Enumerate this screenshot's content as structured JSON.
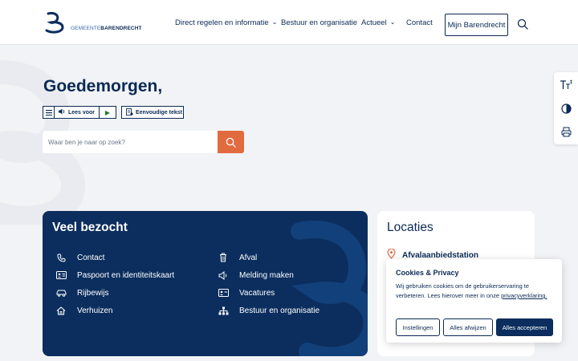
{
  "header": {
    "logo": {
      "prefix": "GEMEENTE",
      "name": "BARENDRECHT"
    },
    "nav": [
      {
        "label": "Direct regelen en informatie",
        "has_dropdown": true
      },
      {
        "label": "Bestuur en organisatie",
        "has_dropdown": false
      },
      {
        "label": "Actueel",
        "has_dropdown": true
      },
      {
        "label": "Contact",
        "has_dropdown": false
      }
    ],
    "mijn_button": "Mijn Barendrecht",
    "search_icon": "search-icon"
  },
  "hero": {
    "greeting": "Goedemorgen,",
    "readspeaker": {
      "label": "Lees voor"
    },
    "simple_text": {
      "label": "Eenvoudige tekst"
    },
    "search": {
      "placeholder": "Waar ben je naar op zoek?"
    }
  },
  "side_toolbar": {
    "items": [
      "text-size-icon",
      "contrast-icon",
      "print-icon"
    ]
  },
  "popular": {
    "title": "Veel bezocht",
    "left": [
      {
        "label": "Contact",
        "icon": "phone-icon"
      },
      {
        "label": "Paspoort en identiteitskaart",
        "icon": "id-card-icon"
      },
      {
        "label": "Rijbewijs",
        "icon": "car-icon"
      },
      {
        "label": "Verhuizen",
        "icon": "home-icon"
      }
    ],
    "right": [
      {
        "label": "Afval",
        "icon": "trash-icon"
      },
      {
        "label": "Melding maken",
        "icon": "megaphone-icon"
      },
      {
        "label": "Vacatures",
        "icon": "badge-icon"
      },
      {
        "label": "Bestuur en organisatie",
        "icon": "org-chart-icon"
      }
    ]
  },
  "locaties": {
    "title": "Locaties",
    "items": [
      {
        "label": "Afvalaanbiedstation",
        "icon": "location-pin-icon"
      }
    ]
  },
  "cookie": {
    "title": "Cookies & Privacy",
    "text": "Wij gebruiken cookies om de gebruikerservaring te verbeteren. Lees hierover meer in onze",
    "link": "privacyverklaring.",
    "buttons": {
      "settings": "Instellingen",
      "reject": "Alles afwijzen",
      "accept": "Alles accepteren"
    }
  },
  "colors": {
    "navy": "#0b2e5e",
    "accent_orange": "#e26a3f",
    "background": "#f2f3f6"
  }
}
